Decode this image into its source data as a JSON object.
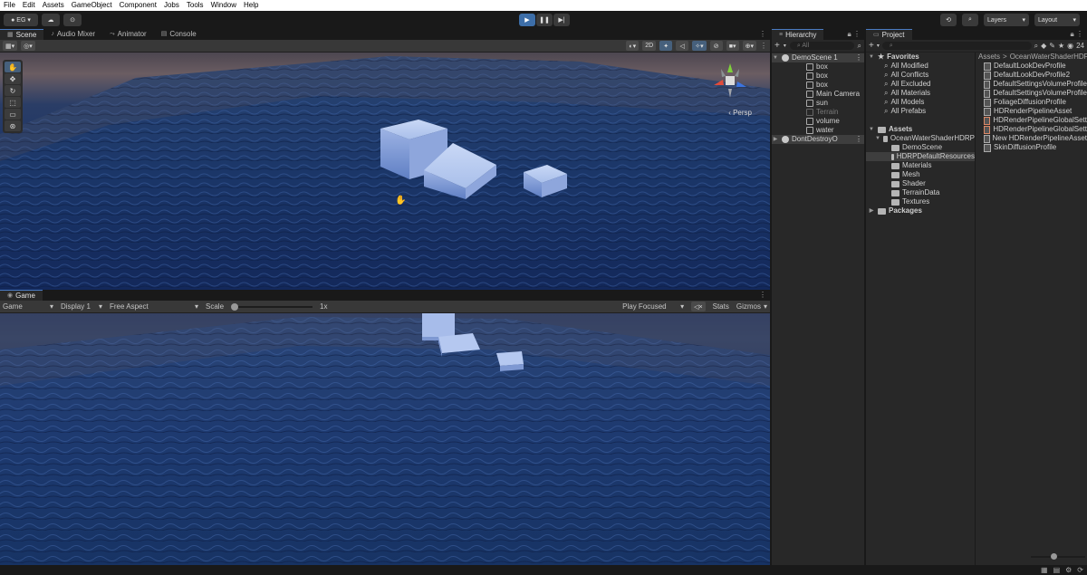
{
  "menubar": [
    "File",
    "Edit",
    "Assets",
    "GameObject",
    "Component",
    "Jobs",
    "Tools",
    "Window",
    "Help"
  ],
  "toolbar": {
    "account": "EG",
    "layers_label": "Layers",
    "layout_label": "Layout"
  },
  "scene_panel": {
    "tabs": [
      "Scene",
      "Audio Mixer",
      "Animator",
      "Console"
    ],
    "btn_2d": "2D",
    "persp_label": "Persp"
  },
  "game_panel": {
    "tab": "Game",
    "display_mode": "Game",
    "display": "Display 1",
    "aspect": "Free Aspect",
    "scale_label": "Scale",
    "scale_value": "1x",
    "play_focused": "Play Focused",
    "stats": "Stats",
    "gizmos": "Gizmos"
  },
  "hierarchy": {
    "tab": "Hierarchy",
    "search_placeholder": "All",
    "scene_name": "DemoScene 1",
    "items": [
      "box",
      "box",
      "box",
      "Main Camera",
      "sun",
      "Terrain",
      "volume",
      "water"
    ],
    "dont_destroy": "DontDestroyO"
  },
  "project": {
    "tab": "Project",
    "count": "24",
    "favorites_label": "Favorites",
    "favorites": [
      "All Modified",
      "All Conflicts",
      "All Excluded",
      "All Materials",
      "All Models",
      "All Prefabs"
    ],
    "assets_label": "Assets",
    "asset_root": "OceanWaterShaderHDRP",
    "folders": [
      "DemoScene",
      "HDRPDefaultResources",
      "Materials",
      "Mesh",
      "Shader",
      "TerrainData",
      "Textures"
    ],
    "packages_label": "Packages",
    "breadcrumb_root": "Assets",
    "breadcrumb_sep": ">",
    "breadcrumb_leaf": "OceanWaterShaderHDRP",
    "files": [
      "DefaultLookDevProfile",
      "DefaultLookDevProfile2",
      "DefaultSettingsVolumeProfile",
      "DefaultSettingsVolumeProfile",
      "FoliageDiffusionProfile",
      "HDRenderPipelineAsset",
      "HDRenderPipelineGlobalSett",
      "HDRenderPipelineGlobalSett",
      "New HDRenderPipelineAsset",
      "SkinDiffusionProfile"
    ]
  }
}
